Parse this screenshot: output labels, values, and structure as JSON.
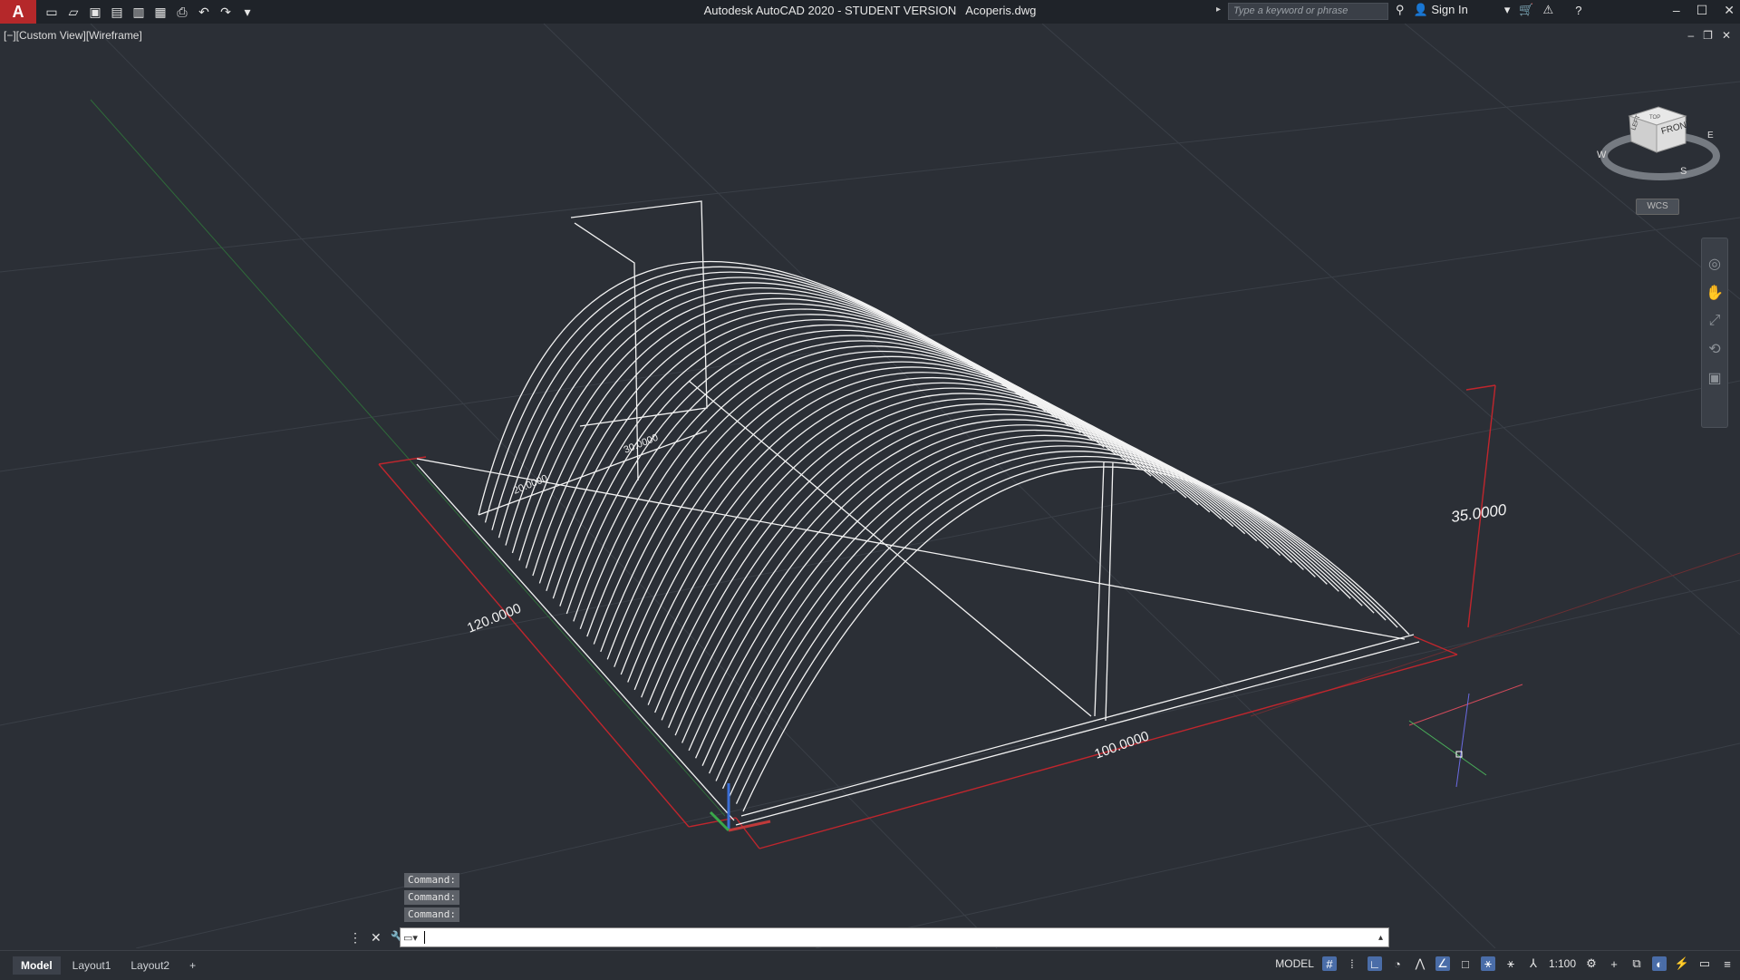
{
  "app": {
    "logo": "A",
    "title": "Autodesk AutoCAD 2020 - STUDENT VERSION",
    "file": "Acoperis.dwg",
    "search_placeholder": "Type a keyword or phrase",
    "sign_in": "Sign In"
  },
  "viewport": {
    "label": "[−][Custom View][Wireframe]",
    "wcs": "WCS",
    "dimensions": {
      "width": "120.0000",
      "length": "100.0000",
      "height": "35.0000",
      "small_a": "30.0000",
      "small_b": "20.0000"
    },
    "viewcube": {
      "front": "FRONT",
      "left": "LEFT",
      "top": "TOP",
      "w": "W",
      "s": "S",
      "e": "E"
    }
  },
  "command": {
    "history": [
      "Command:",
      "Command:",
      "Command:"
    ]
  },
  "status": {
    "tabs": [
      "Model",
      "Layout1",
      "Layout2"
    ],
    "add": "+",
    "model": "MODEL",
    "scale": "1:100"
  }
}
